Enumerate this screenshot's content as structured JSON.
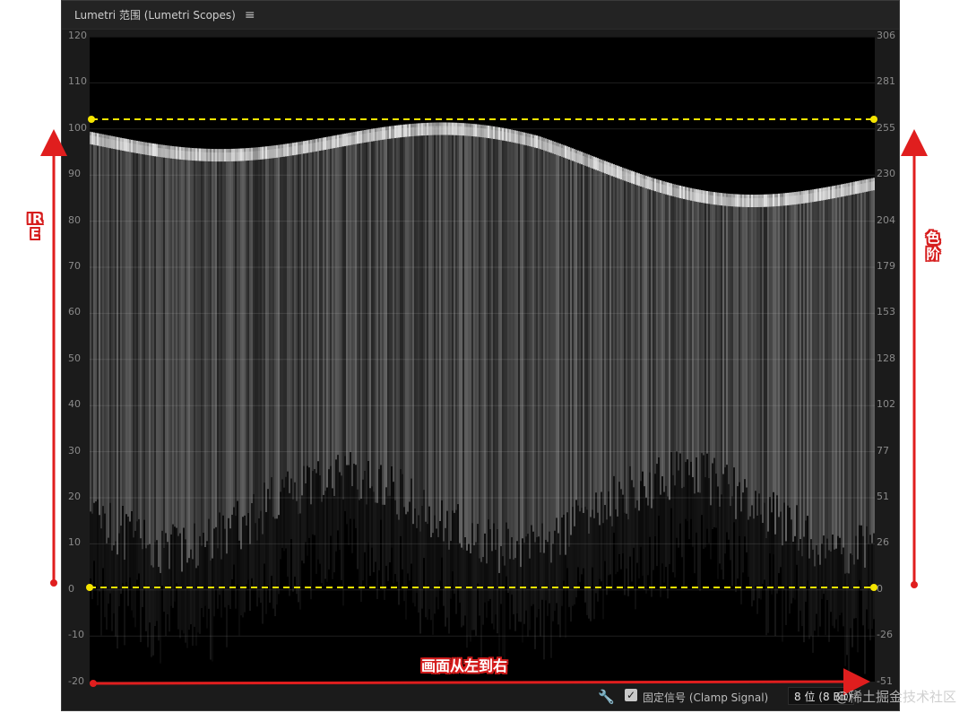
{
  "panel": {
    "title": "Lumetri 范围 (Lumetri Scopes)",
    "menu_icon": "≡"
  },
  "axes": {
    "left_ticks": [
      "120",
      "110",
      "100",
      "90",
      "80",
      "70",
      "60",
      "50",
      "40",
      "30",
      "20",
      "10",
      "0",
      "-10",
      "-20"
    ],
    "right_ticks": [
      "306",
      "281",
      "255",
      "230",
      "204",
      "179",
      "153",
      "128",
      "102",
      "77",
      "51",
      "26",
      "0",
      "-26",
      "-51"
    ]
  },
  "footer": {
    "wrench_icon": "🔧",
    "checkbox_checked": "✓",
    "clamp_label": "固定信号 (Clamp Signal)",
    "bit_depth": "8 位 (8 Bit)"
  },
  "annotations": {
    "ire": "IRE",
    "levels": "色阶",
    "horizontal": "画面从左到右",
    "color": "#e01e1e",
    "guide_color": "#f5e400"
  },
  "watermark": "@稀土掘金技术社区"
}
